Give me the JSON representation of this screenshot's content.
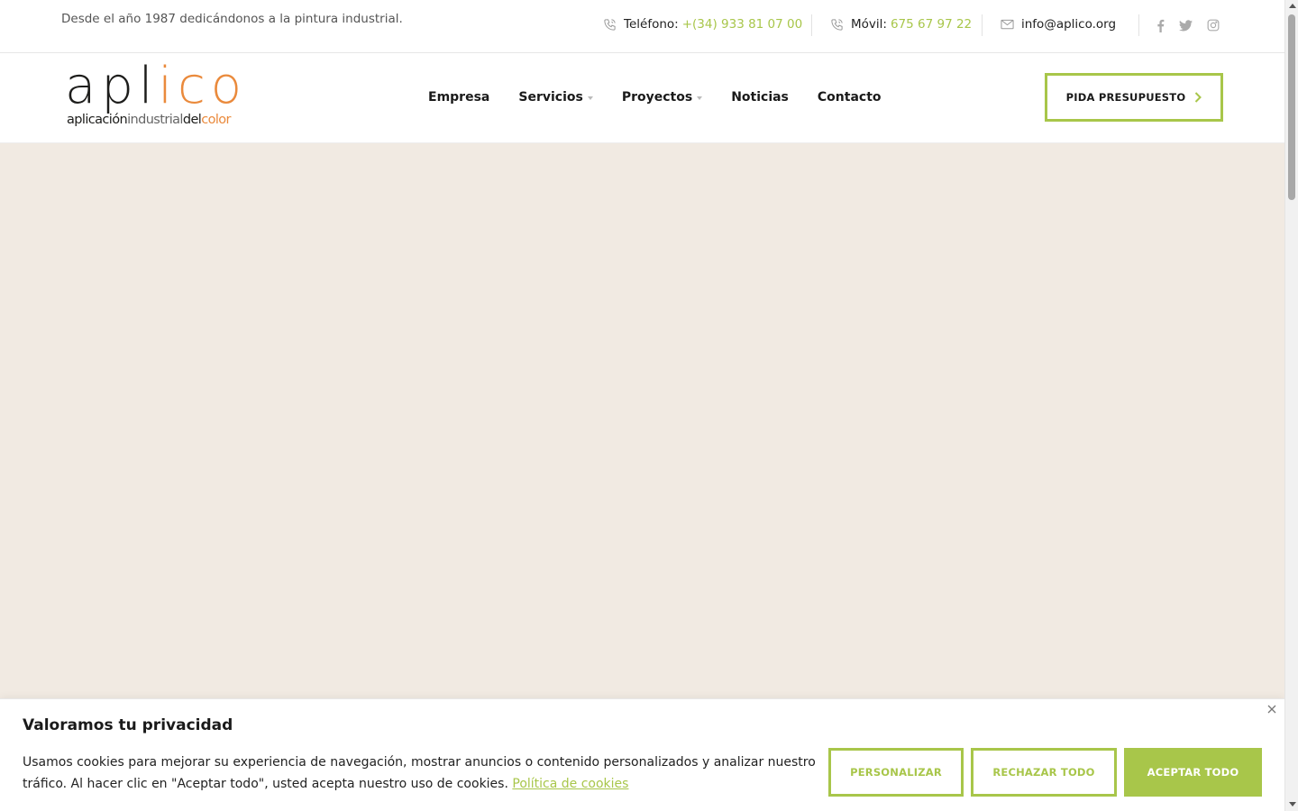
{
  "topbar": {
    "tagline": "Desde el año 1987 dedicándonos a la pintura industrial.",
    "phone_label": "Teléfono:",
    "phone_value": "+(34) 933 81 07 00",
    "mobile_label": "Móvil:",
    "mobile_value": "675 67 97 22",
    "email": "info@aplico.org",
    "social_icons": [
      "facebook-icon",
      "twitter-icon",
      "instagram-icon"
    ]
  },
  "logo": {
    "word_black": "apl",
    "word_orange": "ico",
    "sub_black": "aplicación",
    "sub_gray": "industrial",
    "sub_black2": "del",
    "sub_orange": "color"
  },
  "nav": {
    "items": [
      {
        "label": "Empresa",
        "dropdown": false
      },
      {
        "label": "Servicios",
        "dropdown": true
      },
      {
        "label": "Proyectos",
        "dropdown": true
      },
      {
        "label": "Noticias",
        "dropdown": false
      },
      {
        "label": "Contacto",
        "dropdown": false
      }
    ],
    "cta_label": "PIDA PRESUPUESTO"
  },
  "cookie": {
    "title": "Valoramos tu privacidad",
    "text": "Usamos cookies para mejorar su experiencia de navegación, mostrar anuncios o contenido personalizados y analizar nuestro tráfico. Al hacer clic en \"Aceptar todo\", usted acepta nuestro uso de cookies.",
    "link": "Política de cookies",
    "btn_customize": "PERSONALIZAR",
    "btn_reject": "RECHAZAR TODO",
    "btn_accept": "ACEPTAR TODO"
  },
  "colors": {
    "accent": "#a8c64a",
    "logo_orange": "#ea8a3c",
    "hero_bg": "#f1eae2"
  }
}
